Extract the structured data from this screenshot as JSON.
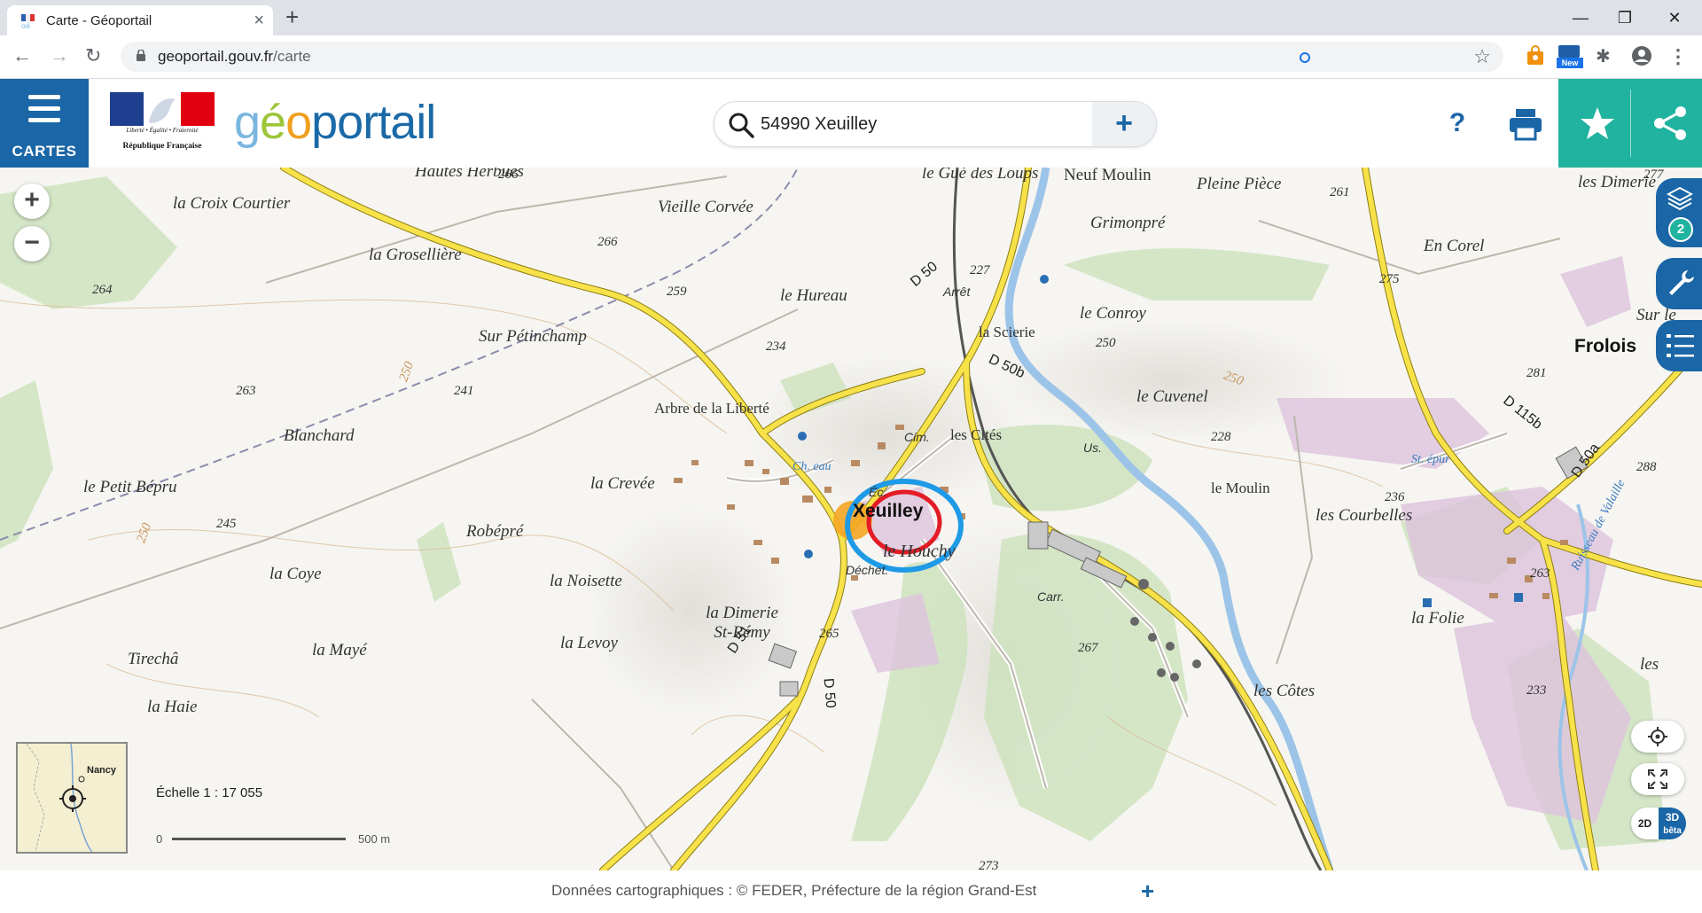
{
  "browser": {
    "tab_title": "Carte - Géoportail",
    "url_host": "geoportail.gouv.fr",
    "url_path": "/carte",
    "window_controls": [
      "minimize-icon",
      "restore-icon",
      "close-icon"
    ],
    "extension_badge": "New"
  },
  "header": {
    "menu_label": "CARTES",
    "republique_line1": "Liberté • Égalité • Fraternité",
    "republique_line2": "République Française",
    "logo_parts": [
      "g",
      "é",
      "o",
      "portail"
    ],
    "search_value": "54990 Xeuilley",
    "help_label": "?",
    "accent_color": "#1a66a6",
    "green_color": "#20b39f"
  },
  "map": {
    "places": [
      "Hautes Herbues",
      "la Croix Courtier",
      "la Grosellière",
      "Vieille Corvée",
      "le Gué des Loups",
      "Neuf Moulin",
      "Pleine Pièce",
      "les Dimerie",
      "Grimonpré",
      "En Corel",
      "le Hureau",
      "Arrêt",
      "la Scierie",
      "le Conroy",
      "Sur Pétinchamp",
      "Sur le",
      "Frolois",
      "Arbre de la Liberté",
      "Blanchard",
      "le Cuvenel",
      "le Petit Bépru",
      "la Crevée",
      "Xeuilley",
      "le Moulin",
      "les Courbelles",
      "Robépré",
      "la Coye",
      "la Noisette",
      "le Houchy",
      "la Dimerie St-Rémy",
      "la Folie",
      "la Levoy",
      "la Mayé",
      "Tirechâ",
      "les Côtes",
      "les",
      "la Haie",
      "Déchet.",
      "Carr.",
      "Cim.",
      "Éc.",
      "Us.",
      "Ch. eau",
      "les Cités",
      "St. épur",
      "Ruisseau de Valaille"
    ],
    "altitudes": [
      "266",
      "266",
      "264",
      "259",
      "234",
      "227",
      "250",
      "241",
      "263",
      "245",
      "228",
      "265",
      "261",
      "277",
      "275",
      "281",
      "236",
      "263",
      "288",
      "267",
      "273",
      "233",
      "250",
      "250",
      "250"
    ],
    "roads": [
      "D 50",
      "D 50b",
      "D 51",
      "D 50",
      "D 115b",
      "D 50a"
    ],
    "zoom_in": "+",
    "zoom_out": "−",
    "layers_count": "2",
    "mode_2d": "2D",
    "mode_3d": "3D",
    "mode_beta": "bêta",
    "overview_city": "Nancy",
    "scale_label": "Échelle 1 : 17 055",
    "scale_zero": "0",
    "scale_end": "500 m"
  },
  "attribution": {
    "text": "Données cartographiques : ©    FEDER,  Préfecture de la région Grand-Est",
    "more": "+"
  }
}
